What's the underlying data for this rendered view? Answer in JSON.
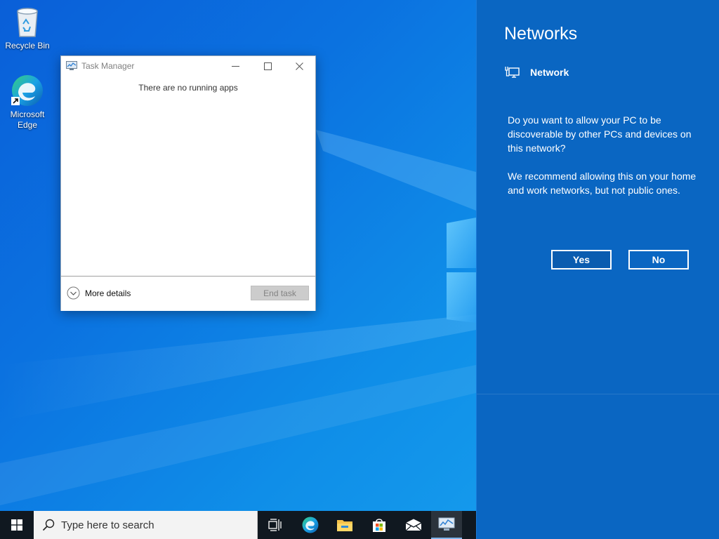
{
  "desktop": {
    "icons": [
      {
        "label": "Recycle Bin",
        "icon": "recycle-bin-icon"
      },
      {
        "label": "Microsoft Edge",
        "icon": "edge-icon"
      }
    ]
  },
  "task_manager": {
    "title": "Task Manager",
    "empty_message": "There are no running apps",
    "more_details_label": "More details",
    "end_task_label": "End task"
  },
  "networks_panel": {
    "heading": "Networks",
    "network_name": "Network",
    "question": "Do you want to allow your PC to be discoverable by other PCs and devices on this network?",
    "recommendation": "We recommend allowing this on your home and work networks, but not public ones.",
    "yes_label": "Yes",
    "no_label": "No",
    "colors": {
      "panel_bg": "#0a66c2",
      "button_selected_bg": "#0a5cb0",
      "text": "#ffffff"
    }
  },
  "taskbar": {
    "search_placeholder": "Type here to search",
    "pinned": [
      "task-view-icon",
      "edge-icon",
      "file-explorer-icon",
      "store-icon",
      "mail-icon",
      "task-manager-icon"
    ],
    "active_app": "task-manager-icon",
    "colors": {
      "bar_bg": "#101820",
      "search_bg": "#f3f3f3"
    }
  }
}
